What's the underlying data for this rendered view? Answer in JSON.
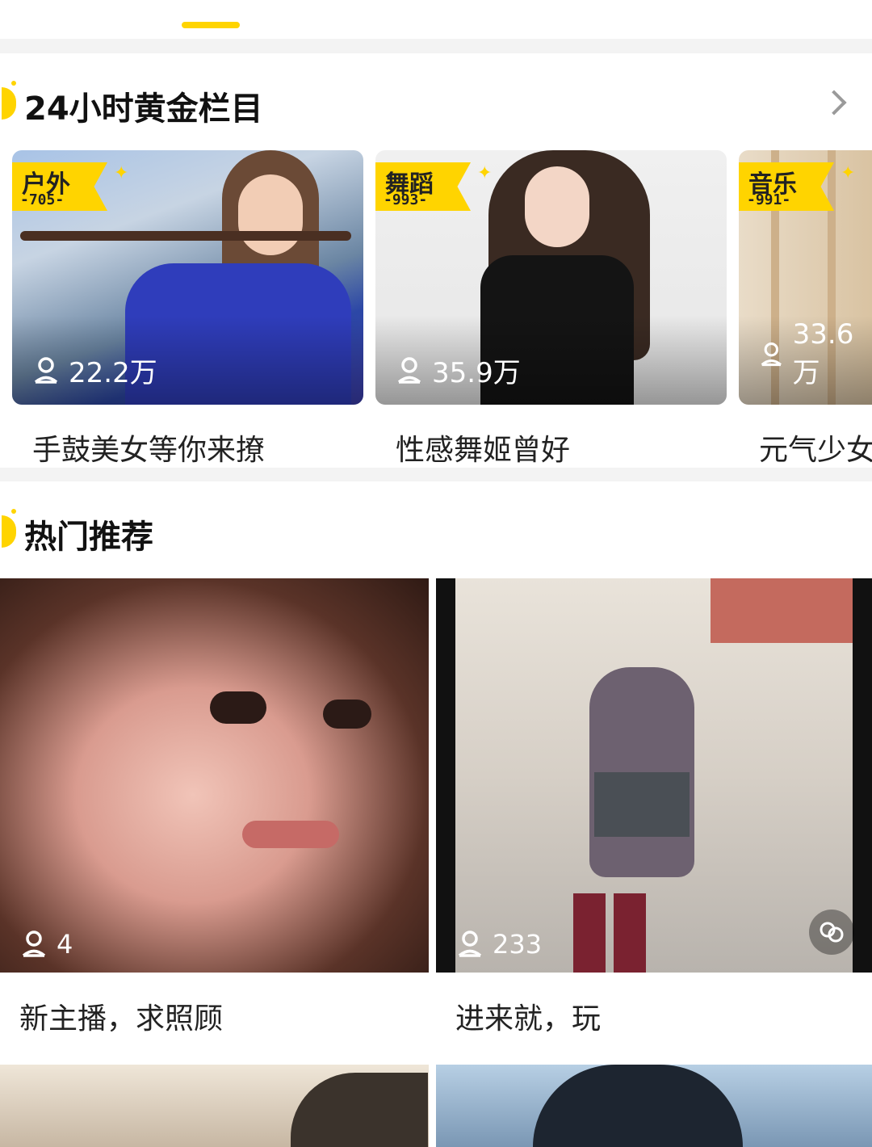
{
  "golden_section": {
    "title": "24小时黄金栏目",
    "cards": [
      {
        "category": "户外",
        "number": "-705-",
        "viewers": "22.2万",
        "caption": "手鼓美女等你来撩"
      },
      {
        "category": "舞蹈",
        "number": "-993-",
        "viewers": "35.9万",
        "caption": "性感舞姬曾好"
      },
      {
        "category": "音乐",
        "number": "-991-",
        "viewers": "33.6万",
        "caption": "元气少女"
      }
    ]
  },
  "hot_section": {
    "title": "热门推荐",
    "items": [
      {
        "viewers": "4",
        "caption": "新主播，求照顾"
      },
      {
        "viewers": "233",
        "caption": "进来就，玩"
      }
    ]
  },
  "colors": {
    "accent": "#ffd400",
    "background": "#f3f3f3",
    "text": "#222222"
  },
  "icons": {
    "person": "person-icon",
    "chevron": "chevron-right-icon",
    "link": "link-icon"
  }
}
